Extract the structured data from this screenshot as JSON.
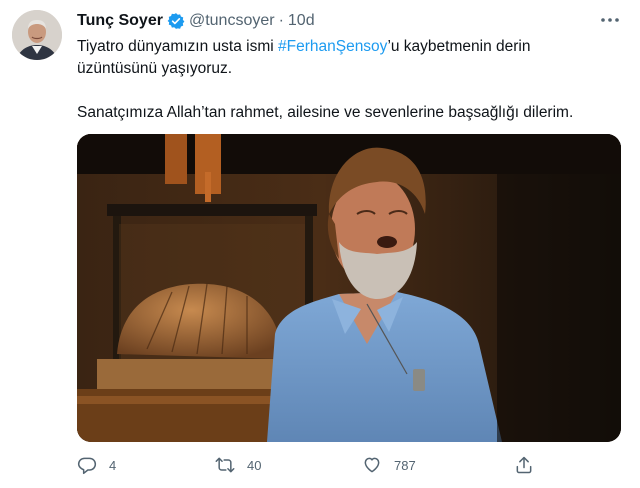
{
  "tweet": {
    "author_name": "Tunç Soyer",
    "handle": "@tuncsoyer",
    "separator": "·",
    "time": "10d",
    "text_prefix": "Tiyatro dünyamızın usta ismi ",
    "hashtag": "#FerhanŞensoy",
    "text_line1_suffix": "’u kaybetmenin derin",
    "text_line2": "üzüntüsünü yaşıyoruz.",
    "text_paragraph2": "Sanatçımıza Allah’tan rahmet, ailesine ve sevenlerine başsağlığı dilerim."
  },
  "actions": {
    "reply_count": "4",
    "retweet_count": "40",
    "like_count": "787"
  },
  "icons": {
    "verified": "verified-badge-icon",
    "more": "more-options-icon",
    "reply": "reply-icon",
    "retweet": "retweet-icon",
    "like": "heart-icon",
    "share": "share-icon"
  },
  "colors": {
    "accent": "#1d9bf0",
    "secondary_text": "#536471",
    "primary_text": "#0f1419"
  }
}
